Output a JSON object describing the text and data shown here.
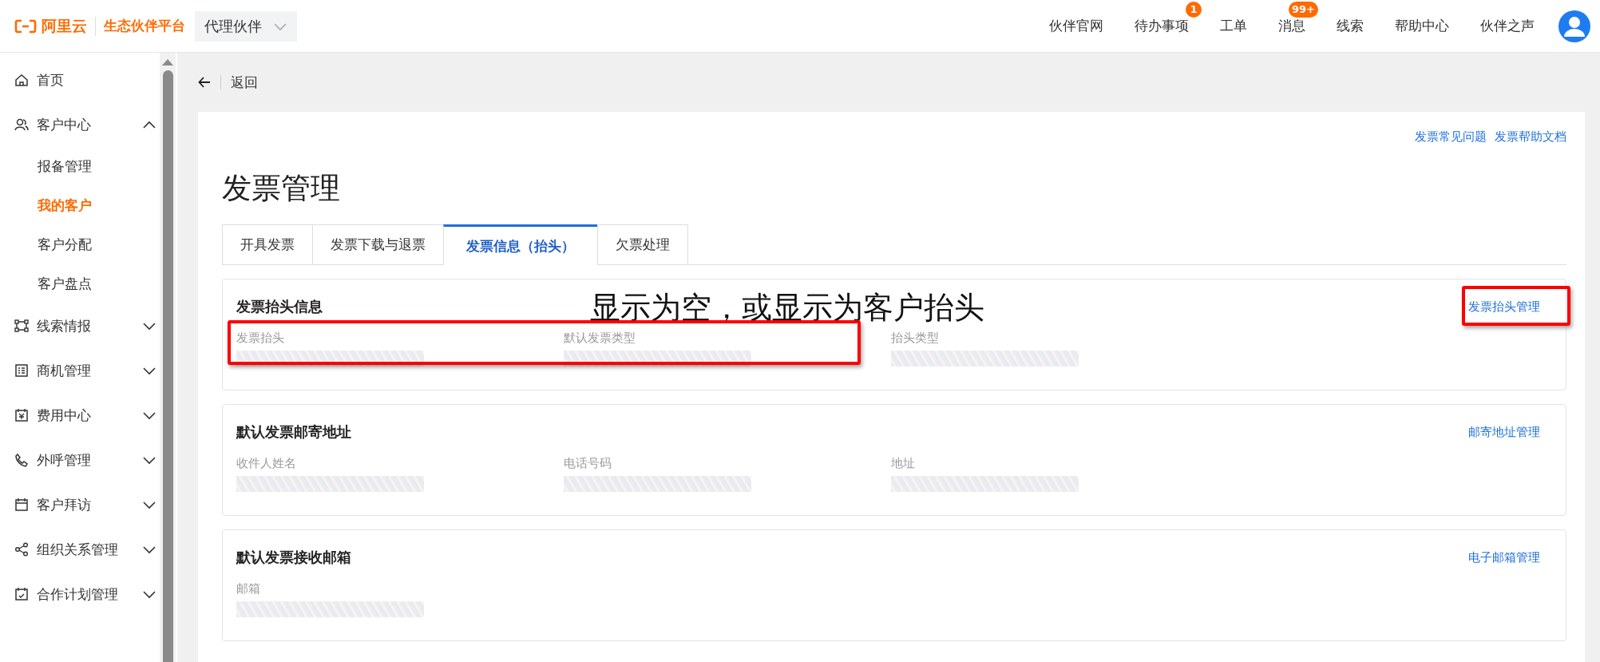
{
  "top_bar": {
    "brand": "阿里云",
    "platform": "生态伙伴平台",
    "role_select": "代理伙伴",
    "nav": [
      {
        "label": "伙伴官网"
      },
      {
        "label": "待办事项",
        "badge": "1"
      },
      {
        "label": "工单"
      },
      {
        "label": "消息",
        "badge": "99+"
      },
      {
        "label": "线索"
      },
      {
        "label": "帮助中心"
      },
      {
        "label": "伙伴之声"
      }
    ]
  },
  "sidebar": {
    "items": [
      {
        "label": "首页",
        "kind": "link"
      },
      {
        "label": "客户中心",
        "kind": "group",
        "expanded": true,
        "children": [
          {
            "label": "报备管理",
            "selected": false
          },
          {
            "label": "我的客户",
            "selected": true
          },
          {
            "label": "客户分配",
            "selected": false
          },
          {
            "label": "客户盘点",
            "selected": false
          }
        ]
      },
      {
        "label": "线索情报",
        "kind": "group",
        "expanded": false
      },
      {
        "label": "商机管理",
        "kind": "group",
        "expanded": false
      },
      {
        "label": "费用中心",
        "kind": "group",
        "expanded": false
      },
      {
        "label": "外呼管理",
        "kind": "group",
        "expanded": false
      },
      {
        "label": "客户拜访",
        "kind": "group",
        "expanded": false
      },
      {
        "label": "组织关系管理",
        "kind": "group",
        "expanded": false
      },
      {
        "label": "合作计划管理",
        "kind": "group",
        "expanded": false
      }
    ]
  },
  "back": "返回",
  "page": {
    "help_links": [
      "发票常见问题",
      "发票帮助文档"
    ],
    "title": "发票管理",
    "tabs": [
      {
        "label": "开具发票",
        "selected": false
      },
      {
        "label": "发票下载与退票",
        "selected": false
      },
      {
        "label": "发票信息（抬头）",
        "selected": true
      },
      {
        "label": "欠票处理",
        "selected": false
      }
    ],
    "sections": [
      {
        "title": "发票抬头信息",
        "action": "发票抬头管理",
        "highlighted": true,
        "fields": [
          {
            "label": "发票抬头",
            "redacted": true
          },
          {
            "label": "默认发票类型",
            "redacted": true
          },
          {
            "label": "抬头类型",
            "redacted": true
          }
        ]
      },
      {
        "title": "默认发票邮寄地址",
        "action": "邮寄地址管理",
        "highlighted": false,
        "fields": [
          {
            "label": "收件人姓名",
            "redacted": true
          },
          {
            "label": "电话号码",
            "redacted": true
          },
          {
            "label": "地址",
            "redacted": true
          }
        ]
      },
      {
        "title": "默认发票接收邮箱",
        "action": "电子邮箱管理",
        "highlighted": false,
        "fields": [
          {
            "label": "邮箱",
            "redacted": true
          }
        ]
      }
    ]
  },
  "annotation": {
    "text": "显示为空，或显示为客户抬头"
  }
}
